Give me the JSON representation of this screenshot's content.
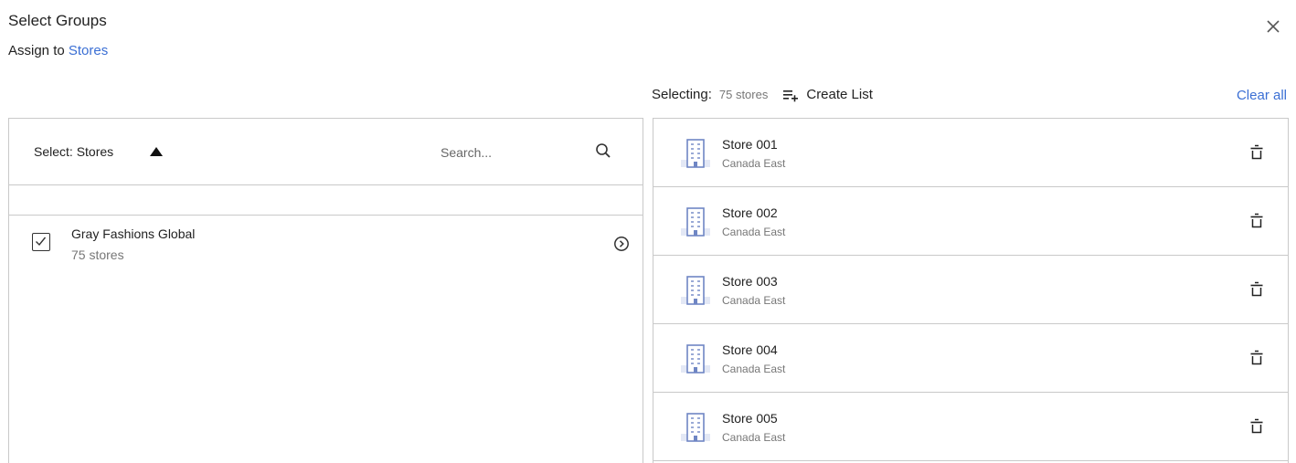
{
  "header": {
    "title": "Select Groups",
    "subtitle_prefix": "Assign to",
    "subtitle_link": "Stores"
  },
  "selecting": {
    "label": "Selecting:",
    "count": "75 stores",
    "create_list": "Create List",
    "clear_all": "Clear all"
  },
  "left": {
    "select_label": "Select: Stores",
    "search_placeholder": "Search...",
    "groups": [
      {
        "name": "Gray Fashions Global",
        "count": "75 stores",
        "checked": true
      }
    ]
  },
  "right": {
    "stores": [
      {
        "name": "Store 001",
        "region": "Canada East"
      },
      {
        "name": "Store 002",
        "region": "Canada East"
      },
      {
        "name": "Store 003",
        "region": "Canada East"
      },
      {
        "name": "Store 004",
        "region": "Canada East"
      },
      {
        "name": "Store 005",
        "region": "Canada East"
      }
    ]
  },
  "colors": {
    "link": "#3b6fd4",
    "border": "#c9c9c9",
    "building_icon": "#6f86c4",
    "muted_text": "#777777"
  },
  "icons": {
    "close": "close-icon",
    "create_list": "playlist-add-icon",
    "sort": "triangle-up-icon",
    "search": "search-icon",
    "checkbox": "checkbox-checked-icon",
    "chevron": "chevron-right-circle-icon",
    "store": "building-icon",
    "remove": "trash-icon"
  }
}
